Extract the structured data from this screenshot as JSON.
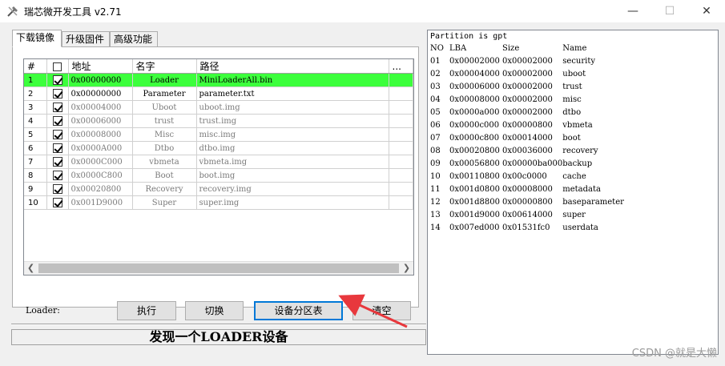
{
  "window": {
    "title": "瑞芯微开发工具 v2.71",
    "controls": [
      "—",
      "☐",
      "✕"
    ]
  },
  "tabs": [
    {
      "label": "下载镜像",
      "active": true
    },
    {
      "label": "升级固件",
      "active": false
    },
    {
      "label": "高级功能",
      "active": false
    }
  ],
  "grid": {
    "columns": [
      "#",
      "",
      "地址",
      "名字",
      "路径",
      "..."
    ],
    "rows": [
      {
        "num": "1",
        "checked": true,
        "address": "0x00000000",
        "name": "Loader",
        "path": "MiniLoaderAll.bin"
      },
      {
        "num": "2",
        "checked": true,
        "address": "0x00000000",
        "name": "Parameter",
        "path": "parameter.txt"
      },
      {
        "num": "3",
        "checked": true,
        "address": "0x00004000",
        "name": "Uboot",
        "path": "uboot.img"
      },
      {
        "num": "4",
        "checked": true,
        "address": "0x00006000",
        "name": "trust",
        "path": "trust.img"
      },
      {
        "num": "5",
        "checked": true,
        "address": "0x00008000",
        "name": "Misc",
        "path": "misc.img"
      },
      {
        "num": "6",
        "checked": true,
        "address": "0x0000A000",
        "name": "Dtbo",
        "path": "dtbo.img"
      },
      {
        "num": "7",
        "checked": true,
        "address": "0x0000C000",
        "name": "vbmeta",
        "path": "vbmeta.img"
      },
      {
        "num": "8",
        "checked": true,
        "address": "0x0000C800",
        "name": "Boot",
        "path": "boot.img"
      },
      {
        "num": "9",
        "checked": true,
        "address": "0x00020800",
        "name": "Recovery",
        "path": "recovery.img"
      },
      {
        "num": "10",
        "checked": true,
        "address": "0x001D9000",
        "name": "Super",
        "path": "super.img"
      }
    ]
  },
  "loader_label": "Loader:",
  "buttons": {
    "execute": "执行",
    "switch": "切换",
    "partition_table": "设备分区表",
    "clear": "清空"
  },
  "status": "发现一个LOADER设备",
  "log": {
    "header_line": "Partition is gpt",
    "columns": [
      "NO",
      "LBA",
      "Size",
      "Name"
    ],
    "rows": [
      [
        "01",
        "0x00002000",
        "0x00002000",
        "security"
      ],
      [
        "02",
        "0x00004000",
        "0x00002000",
        "uboot"
      ],
      [
        "03",
        "0x00006000",
        "0x00002000",
        "trust"
      ],
      [
        "04",
        "0x00008000",
        "0x00002000",
        "misc"
      ],
      [
        "05",
        "0x0000a000",
        "0x00002000",
        "dtbo"
      ],
      [
        "06",
        "0x0000c000",
        "0x00000800",
        "vbmeta"
      ],
      [
        "07",
        "0x0000c800",
        "0x00014000",
        "boot"
      ],
      [
        "08",
        "0x00020800",
        "0x00036000",
        "recovery"
      ],
      [
        "09",
        "0x00056800",
        "0x00000ba000",
        "backup"
      ],
      [
        "10",
        "0x00110800",
        "0x00c0000",
        "cache"
      ],
      [
        "11",
        "0x001d0800",
        "0x00008000",
        "metadata"
      ],
      [
        "12",
        "0x001d8800",
        "0x00000800",
        "baseparameter"
      ],
      [
        "13",
        "0x001d9000",
        "0x00614000",
        "super"
      ],
      [
        "14",
        "0x007ed000",
        "0x01531fc0",
        "userdata"
      ]
    ]
  },
  "watermark": "CSDN @就是大懒",
  "colors": {
    "selected_row": "#3cff3c",
    "primary_button_border": "#0078d7",
    "annotation_arrow": "#e8383d"
  }
}
